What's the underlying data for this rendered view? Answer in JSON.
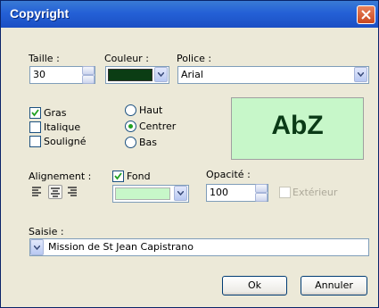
{
  "window": {
    "title": "Copyright"
  },
  "size": {
    "label": "Taille :",
    "value": "30"
  },
  "color": {
    "label": "Couleur :",
    "swatch": "#0b3d14"
  },
  "font": {
    "label": "Police :",
    "value": "Arial"
  },
  "styles": {
    "bold": {
      "label": "Gras",
      "checked": true
    },
    "italic": {
      "label": "Italique",
      "checked": false
    },
    "underline": {
      "label": "Souligné",
      "checked": false
    }
  },
  "position": {
    "top": {
      "label": "Haut",
      "selected": false
    },
    "center": {
      "label": "Centrer",
      "selected": true
    },
    "bottom": {
      "label": "Bas",
      "selected": false
    }
  },
  "preview": {
    "text": "AbZ",
    "background": "#c7f7c9",
    "text_color": "#0a3a16"
  },
  "alignment": {
    "label": "Alignement :",
    "selected": "center"
  },
  "background": {
    "label": "Fond",
    "checked": true,
    "swatch": "#c7f7c9"
  },
  "opacity": {
    "label": "Opacité :",
    "value": "100"
  },
  "outside": {
    "label": "Extérieur",
    "checked": false,
    "enabled": false
  },
  "input": {
    "label": "Saisie :",
    "value": "Mission de St Jean Capistrano"
  },
  "buttons": {
    "ok": "Ok",
    "cancel": "Annuler"
  }
}
